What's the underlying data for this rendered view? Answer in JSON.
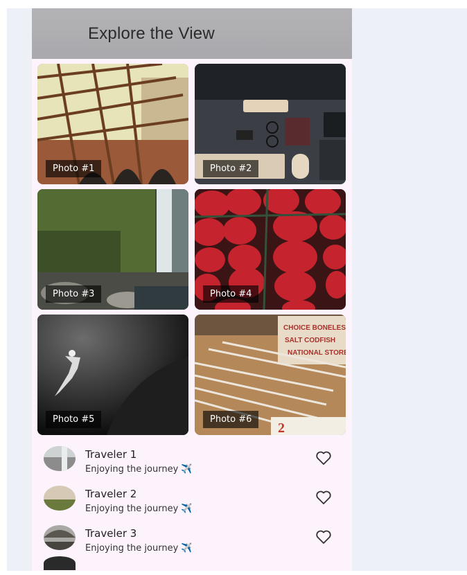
{
  "app": {
    "title": "Explore the View"
  },
  "photos": [
    {
      "caption": "Photo #1",
      "scene": "steel-dome-architecture"
    },
    {
      "caption": "Photo #2",
      "scene": "desk-flatlay"
    },
    {
      "caption": "Photo #3",
      "scene": "waterfall-moss"
    },
    {
      "caption": "Photo #4",
      "scene": "strawberries"
    },
    {
      "caption": "Photo #5",
      "scene": "diver-dark-water"
    },
    {
      "caption": "Photo #6",
      "scene": "printing-type"
    }
  ],
  "travelers": [
    {
      "name": "Traveler 1",
      "status": "Enjoying the journey",
      "emoji": "✈️",
      "icon": "heart-outline-icon"
    },
    {
      "name": "Traveler 2",
      "status": "Enjoying the journey",
      "emoji": "✈️",
      "icon": "heart-outline-icon"
    },
    {
      "name": "Traveler 3",
      "status": "Enjoying the journey",
      "emoji": "✈️",
      "icon": "heart-outline-icon"
    }
  ],
  "colors": {
    "appbar": "#b0b0b3",
    "background": "#fdf3fc",
    "caption_bg": "#000000a0"
  }
}
